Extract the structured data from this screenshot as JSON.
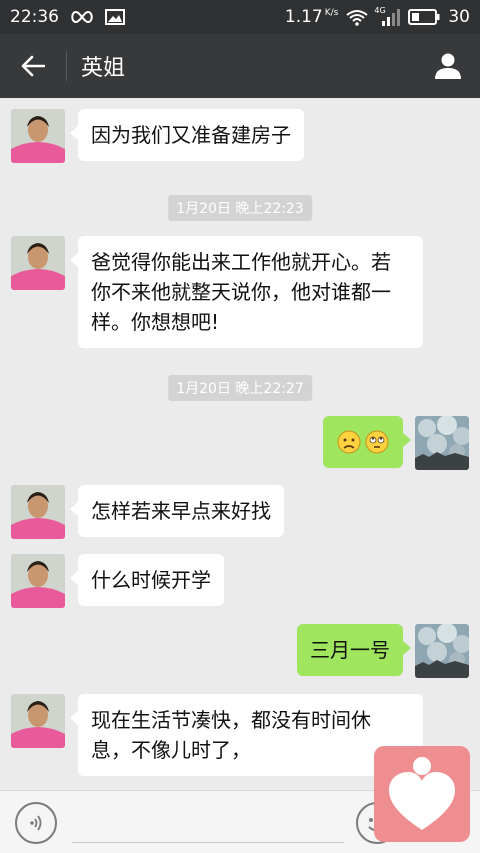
{
  "status_bar": {
    "time": "22:36",
    "speed_value": "1.17",
    "speed_unit": "K/s",
    "network_label": "4G",
    "battery_level": "30"
  },
  "header": {
    "title": "英姐"
  },
  "messages": [
    {
      "side": "left",
      "text_lines": [
        "因为我们又准备建房子"
      ]
    },
    {
      "timestamp": "1月20日 晚上22:23"
    },
    {
      "side": "left",
      "text_lines": [
        "爸觉得你能出来工作他就开心。若",
        "你不来他就整天说你，他对谁都一",
        "样。你想想吧!"
      ]
    },
    {
      "timestamp": "1月20日 晚上22:27"
    },
    {
      "side": "right",
      "content": "emoji",
      "emojis": [
        "sad-face-emoji",
        "rolling-eyes-emoji"
      ]
    },
    {
      "side": "left",
      "text_lines": [
        "怎样若来早点来好找"
      ]
    },
    {
      "side": "left",
      "text_lines": [
        "什么时候开学"
      ]
    },
    {
      "side": "right",
      "text_lines": [
        "三月一号"
      ]
    },
    {
      "side": "left",
      "text_lines": [
        "现在生活节凑快，都没有时间休",
        "息，不像儿时了，"
      ]
    }
  ],
  "input_bar": {
    "value": ""
  },
  "colors": {
    "status_bar_bg": "#2f3133",
    "title_bar_bg": "#38393b",
    "chat_bg": "#ebebeb",
    "bubble_sent": "#9fe55e",
    "bubble_received": "#ffffff",
    "floating_button": "#ef8e90"
  }
}
